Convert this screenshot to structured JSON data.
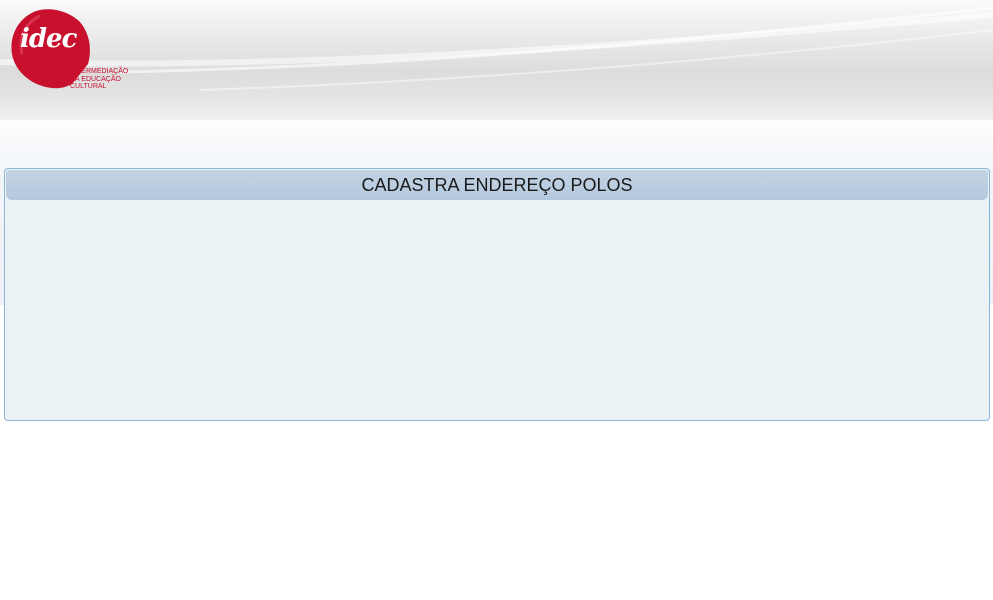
{
  "brand": {
    "logo_word": "idec",
    "tagline": "INTERMEDIAÇÃO\nDA EDUCAÇÃO\nCULTURAL",
    "color": "#c8102e"
  },
  "panel": {
    "title": "CADASTRA ENDEREÇO POLOS"
  }
}
